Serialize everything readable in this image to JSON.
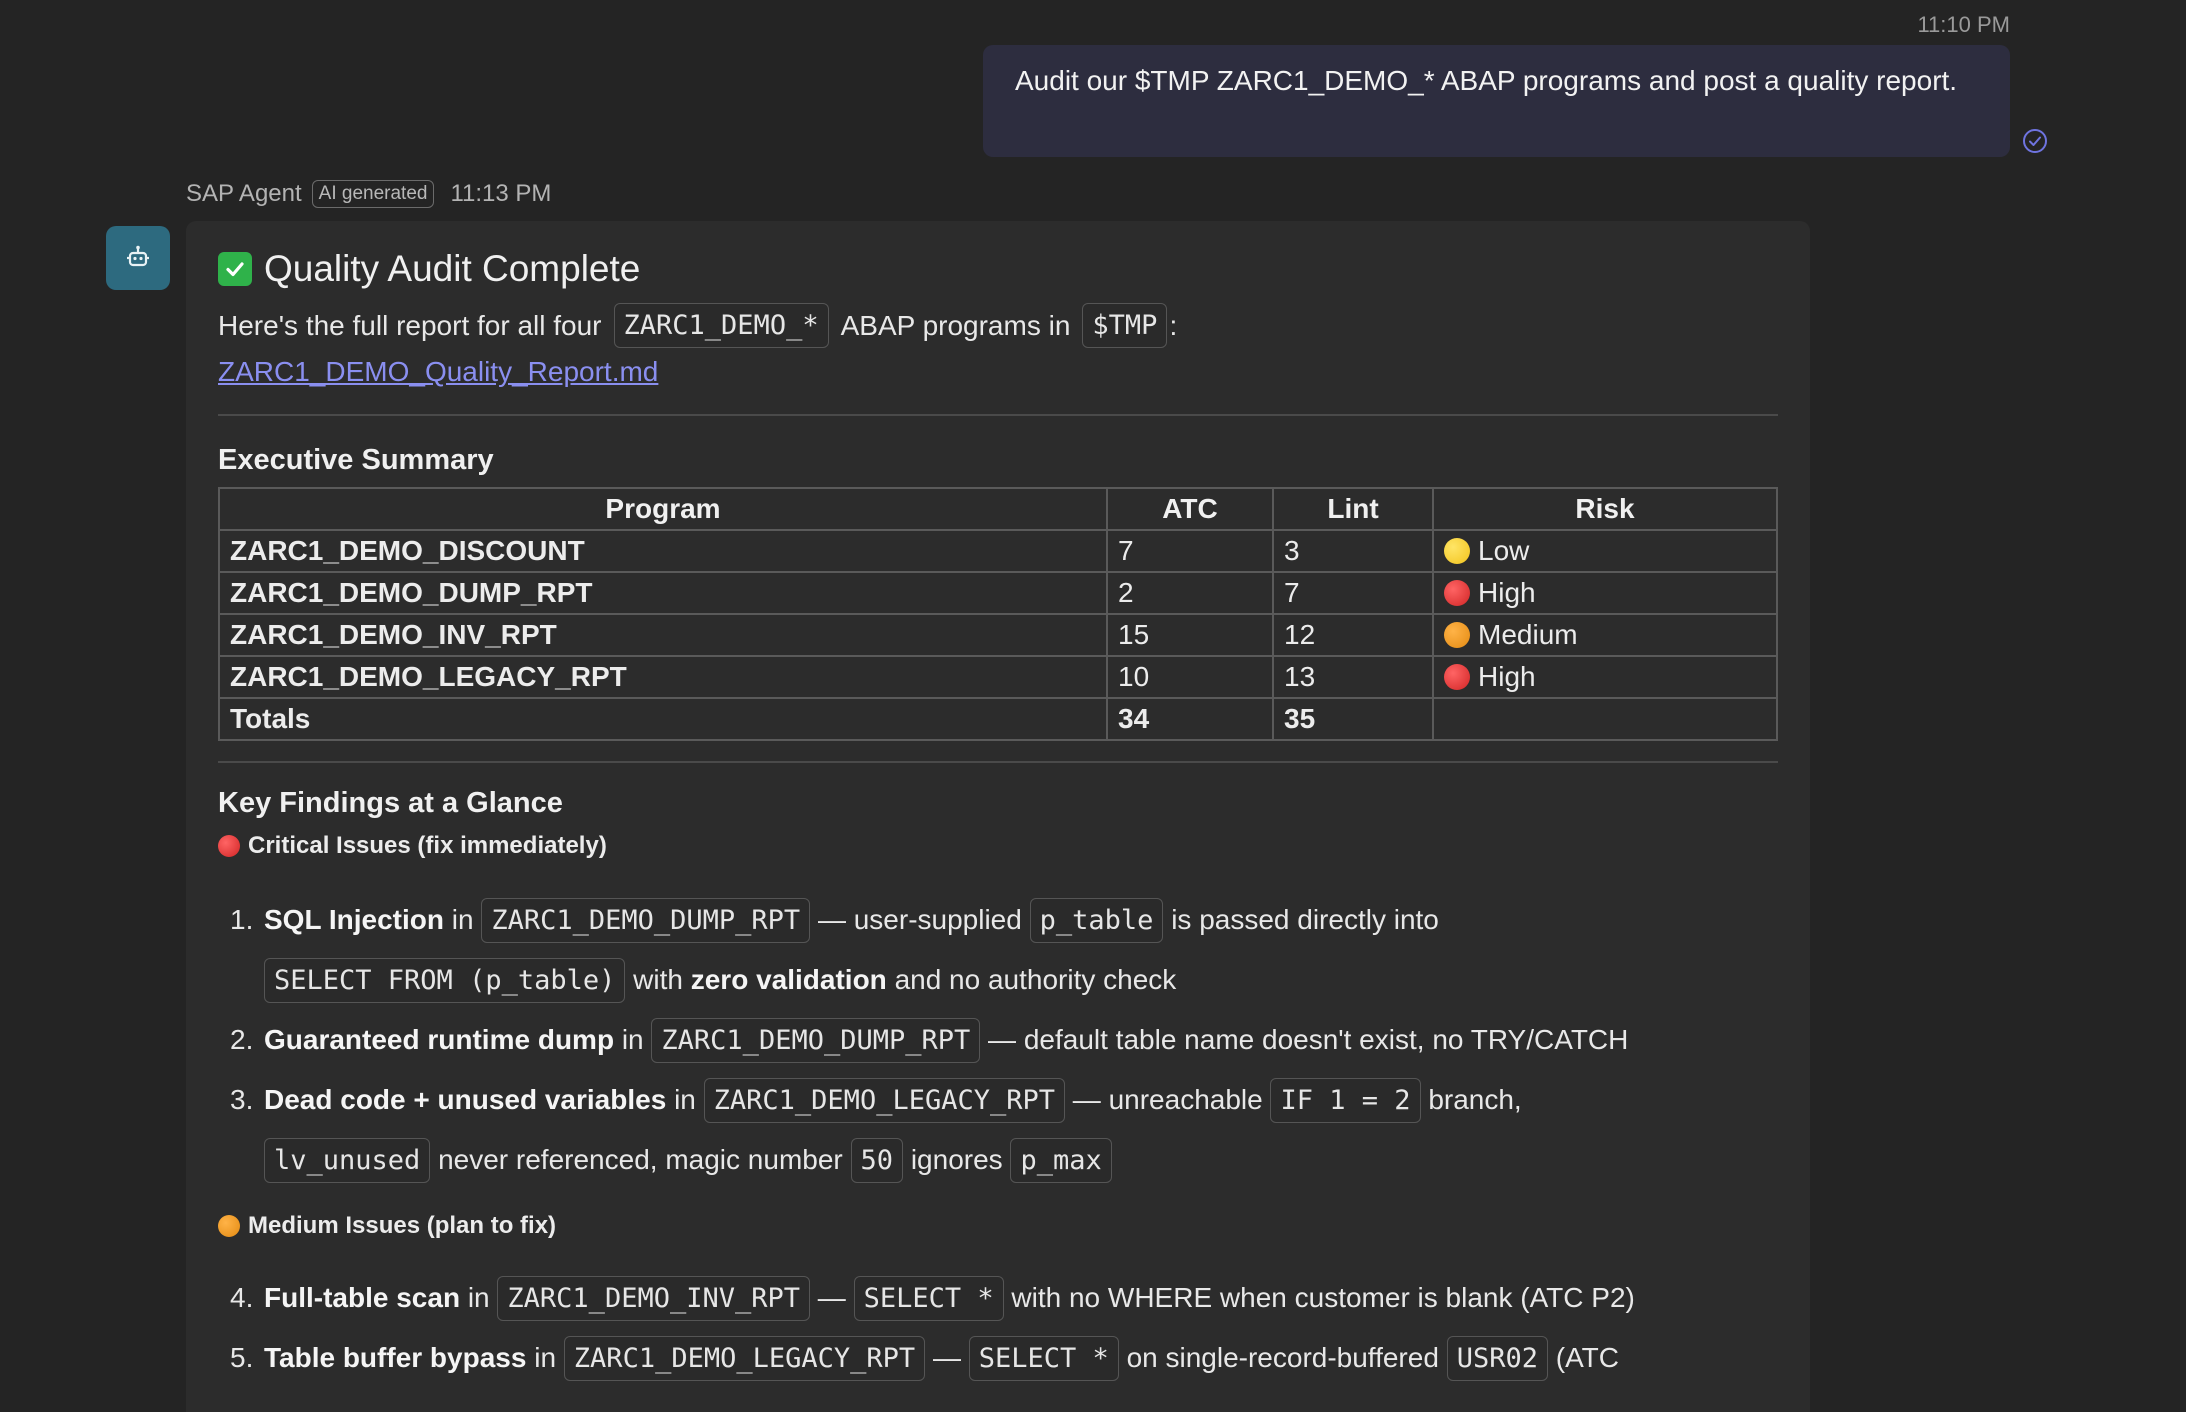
{
  "user": {
    "time": "11:10 PM",
    "message": "Audit our $TMP ZARC1_DEMO_* ABAP programs and post a quality report."
  },
  "agent": {
    "name": "SAP Agent",
    "badge": "AI generated",
    "time": "11:13 PM",
    "avatar_icon": "robot-icon"
  },
  "report": {
    "title": "Quality Audit Complete",
    "intro_prefix": "Here's the full report for all four",
    "intro_code1": "ZARC1_DEMO_*",
    "intro_mid": "ABAP programs in",
    "intro_code2": "$TMP",
    "intro_suffix": ":",
    "link": "ZARC1_DEMO_Quality_Report.md",
    "summary_heading": "Executive Summary",
    "table": {
      "headers": [
        "Program",
        "ATC",
        "Lint",
        "Risk"
      ],
      "rows": [
        {
          "program": "ZARC1_DEMO_DISCOUNT",
          "atc": "7",
          "lint": "3",
          "risk": "Low",
          "color": "#f2c31c"
        },
        {
          "program": "ZARC1_DEMO_DUMP_RPT",
          "atc": "2",
          "lint": "7",
          "risk": "High",
          "color": "#d12525"
        },
        {
          "program": "ZARC1_DEMO_INV_RPT",
          "atc": "15",
          "lint": "12",
          "risk": "Medium",
          "color": "#e38a12"
        },
        {
          "program": "ZARC1_DEMO_LEGACY_RPT",
          "atc": "10",
          "lint": "13",
          "risk": "High",
          "color": "#d12525"
        }
      ],
      "totals": {
        "label": "Totals",
        "atc": "34",
        "lint": "35"
      }
    },
    "findings_heading": "Key Findings at a Glance",
    "critical_heading": "Critical Issues (fix immediately)",
    "critical": [
      {
        "num": "1.",
        "title": "SQL Injection",
        "in": "in",
        "program": "ZARC1_DEMO_DUMP_RPT",
        "t1": "— user-supplied",
        "c1": "p_table",
        "t2": "is passed directly into",
        "c2": "SELECT FROM (p_table)",
        "t3": "with",
        "b1": "zero validation",
        "t4": "and no authority check"
      },
      {
        "num": "2.",
        "title": "Guaranteed runtime dump",
        "in": "in",
        "program": "ZARC1_DEMO_DUMP_RPT",
        "t1": "— default table name doesn't exist, no TRY/CATCH"
      },
      {
        "num": "3.",
        "title": "Dead code + unused variables",
        "in": "in",
        "program": "ZARC1_DEMO_LEGACY_RPT",
        "t1": "— unreachable",
        "c1": "IF 1 = 2",
        "t2": "branch,",
        "c2": "lv_unused",
        "t3": "never referenced, magic number",
        "c3": "50",
        "t4": "ignores",
        "c4": "p_max"
      }
    ],
    "medium_heading": "Medium Issues (plan to fix)",
    "medium": [
      {
        "num": "4.",
        "title": "Full-table scan",
        "in": "in",
        "program": "ZARC1_DEMO_INV_RPT",
        "t1": "—",
        "c1": "SELECT *",
        "t2": "with no WHERE when customer is blank (ATC P2)"
      },
      {
        "num": "5.",
        "title": "Table buffer bypass",
        "in": "in",
        "program": "ZARC1_DEMO_LEGACY_RPT",
        "t1": "—",
        "c1": "SELECT *",
        "t2": "on single-record-buffered",
        "c2": "USR02",
        "t3": "(ATC"
      }
    ]
  },
  "colors": {
    "background": "#242424",
    "card": "#2c2c2c",
    "user_bubble": "#2d2d3f",
    "avatar": "#2d6a7f",
    "link": "#8a8ff0",
    "check": "#2fb24a"
  }
}
